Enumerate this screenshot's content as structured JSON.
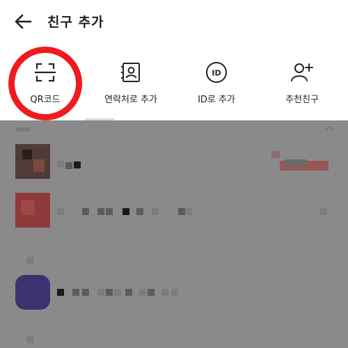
{
  "header": {
    "title": "친구 추가",
    "back_icon": "arrow-left-icon"
  },
  "options": [
    {
      "label": "QR코드",
      "icon": "qr-scan-icon"
    },
    {
      "label": "연락처로 추가",
      "icon": "contact-book-icon"
    },
    {
      "label": "ID로 추가",
      "icon": "id-badge-icon"
    },
    {
      "label": "추천친구",
      "icon": "person-add-icon"
    }
  ],
  "colors": {
    "highlight_ring": "#f01a1e",
    "overlay": "#8a8a8a",
    "text": "#222222"
  }
}
